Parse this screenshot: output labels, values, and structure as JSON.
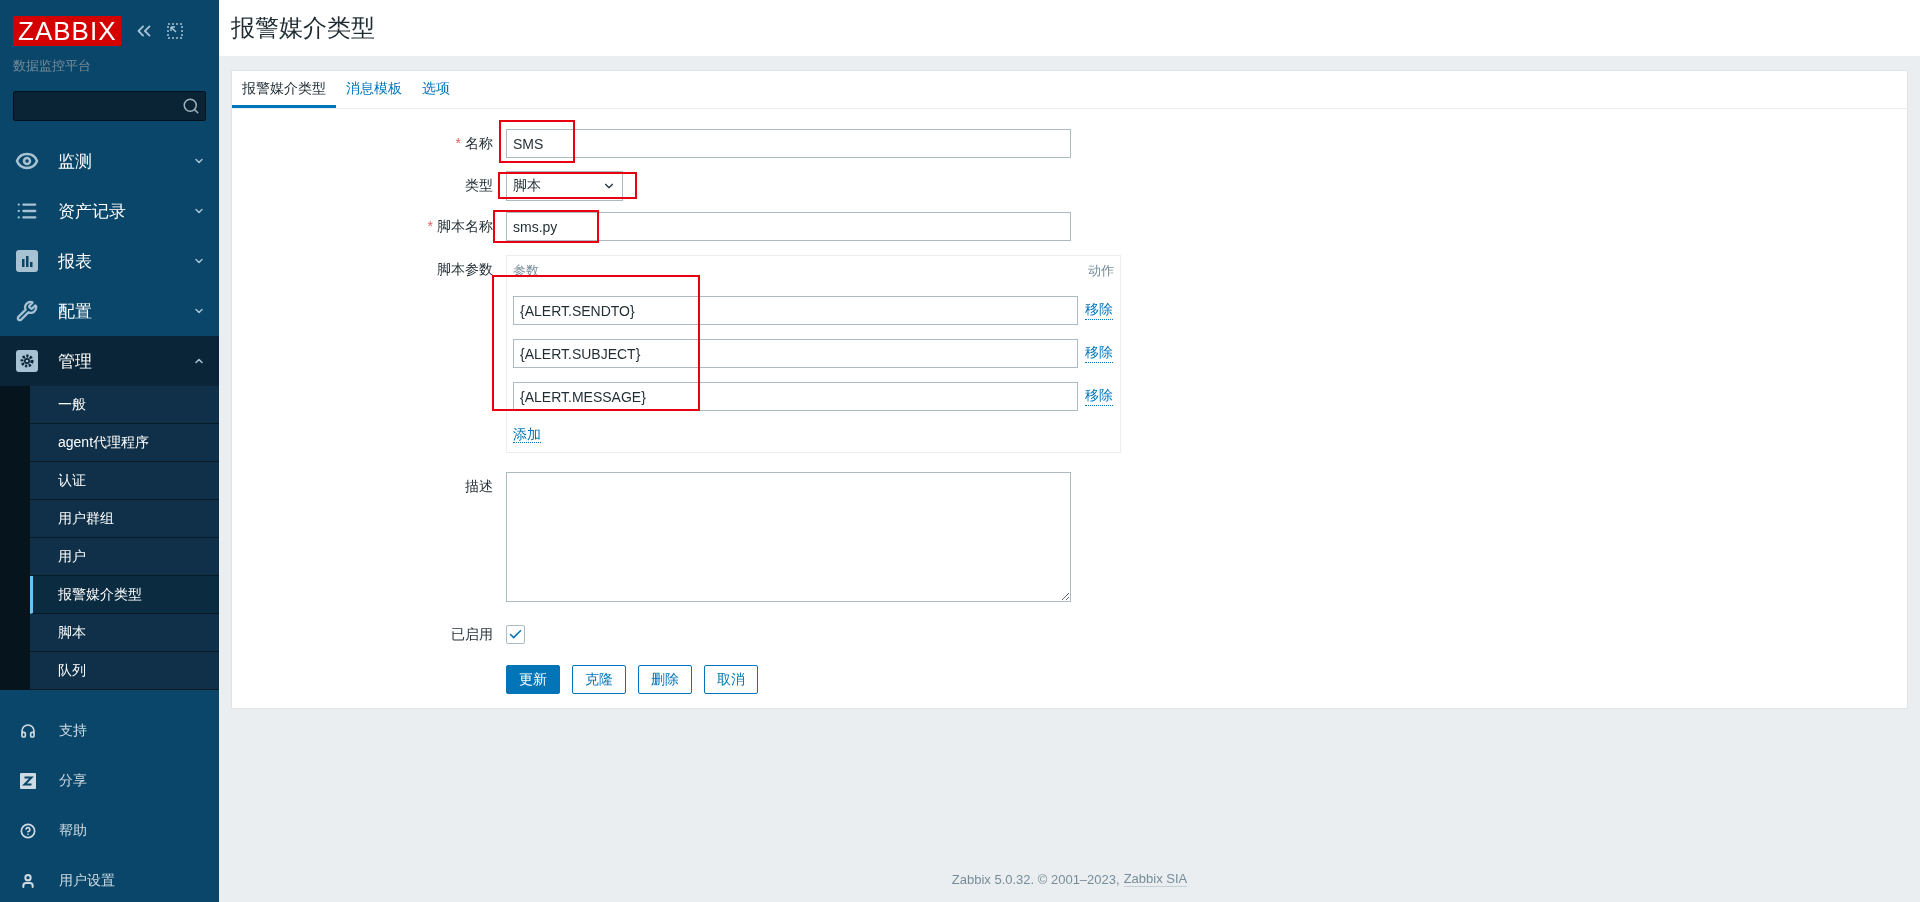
{
  "sidebar": {
    "logo": "ZABBIX",
    "subtitle": "数据监控平台",
    "menu": [
      {
        "kind": "monitoring",
        "label": "监测",
        "expanded": false
      },
      {
        "kind": "inventory",
        "label": "资产记录",
        "expanded": false
      },
      {
        "kind": "reports",
        "label": "报表",
        "expanded": false
      },
      {
        "kind": "configuration",
        "label": "配置",
        "expanded": false
      },
      {
        "kind": "administration",
        "label": "管理",
        "expanded": true,
        "children": [
          {
            "label": "一般",
            "selected": false
          },
          {
            "label": "agent代理程序",
            "selected": false
          },
          {
            "label": "认证",
            "selected": false
          },
          {
            "label": "用户群组",
            "selected": false
          },
          {
            "label": "用户",
            "selected": false
          },
          {
            "label": "报警媒介类型",
            "selected": true
          },
          {
            "label": "脚本",
            "selected": false
          },
          {
            "label": "队列",
            "selected": false
          }
        ]
      }
    ],
    "bottom": [
      {
        "kind": "support",
        "label": "支持"
      },
      {
        "kind": "share",
        "label": "分享"
      },
      {
        "kind": "help",
        "label": "帮助"
      },
      {
        "kind": "user",
        "label": "用户设置"
      }
    ]
  },
  "page_title": "报警媒介类型",
  "tabs": [
    {
      "label": "报警媒介类型",
      "selected": true
    },
    {
      "label": "消息模板",
      "selected": false
    },
    {
      "label": "选项",
      "selected": false
    }
  ],
  "form": {
    "name": {
      "label": "名称",
      "required_mark": "*",
      "value": "SMS",
      "marked": true
    },
    "type": {
      "label": "类型",
      "value": "脚本",
      "marked": true
    },
    "script_name": {
      "label": "脚本名称",
      "required_mark": "*",
      "value": "sms.py",
      "marked": true
    },
    "script_params": {
      "label": "脚本参数",
      "column_param": "参数",
      "column_action": "动作",
      "marked": true,
      "rows": [
        {
          "value": "{ALERT.SENDTO}",
          "action": "移除"
        },
        {
          "value": "{ALERT.SUBJECT}",
          "action": "移除"
        },
        {
          "value": "{ALERT.MESSAGE}",
          "action": "移除"
        }
      ],
      "add": "添加"
    },
    "description": {
      "label": "描述"
    },
    "enabled": {
      "label": "已启用",
      "checked": true
    }
  },
  "buttons": [
    {
      "label": "更新",
      "primary": true
    },
    {
      "label": "克隆",
      "primary": false
    },
    {
      "label": "删除",
      "primary": false
    },
    {
      "label": "取消",
      "primary": false
    }
  ],
  "footer": {
    "text": "Zabbix 5.0.32. © 2001–2023,",
    "link": "Zabbix SIA"
  }
}
